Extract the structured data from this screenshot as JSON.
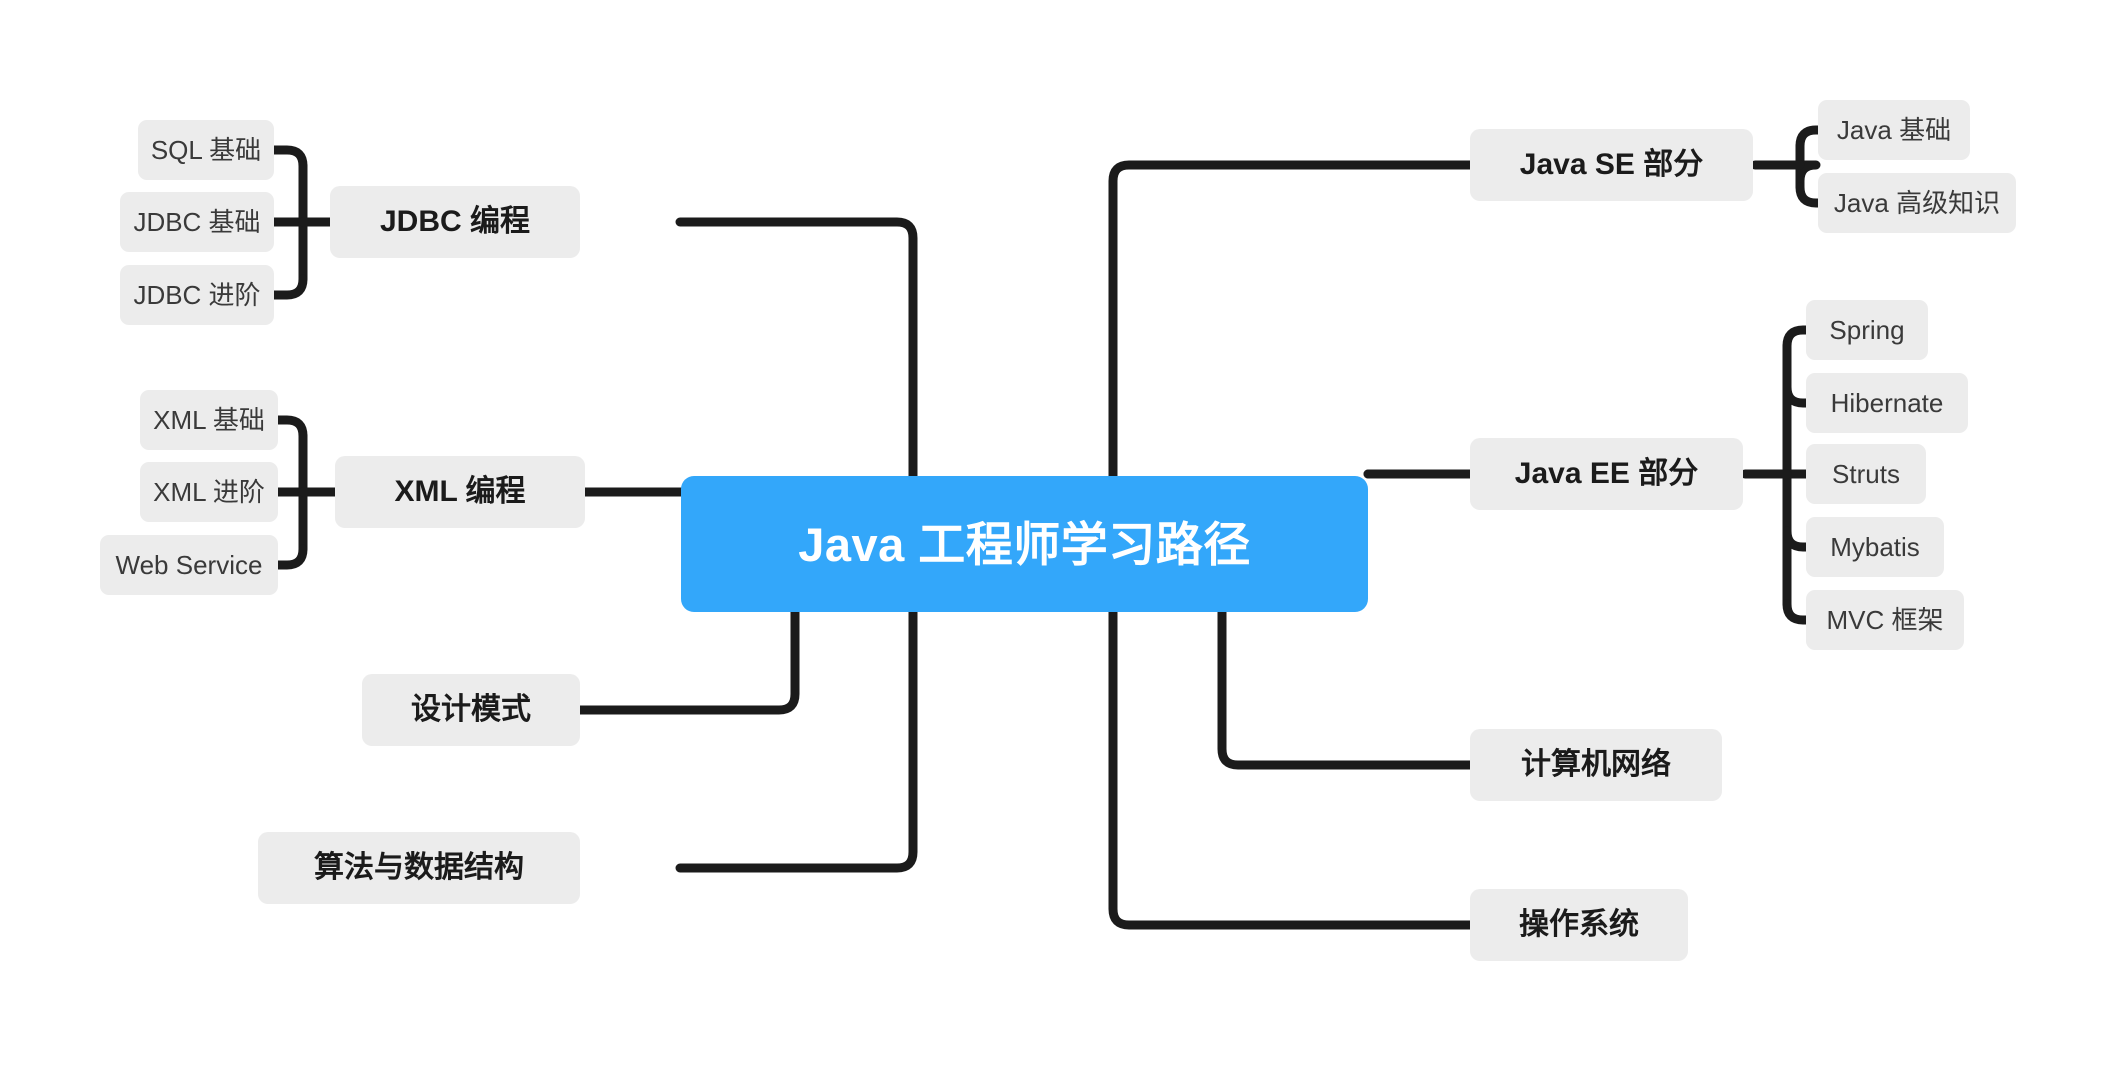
{
  "diagram": {
    "type": "mindmap",
    "title": "Java 工程师学习路径",
    "orientation": "horizontal-bidirectional",
    "colors": {
      "root_background": "#33a7fa",
      "root_text": "#ffffff",
      "node_background": "#ececec",
      "branch_text": "#1b1b1b",
      "leaf_text": "#3a3a3a",
      "connector": "#1b1b1b",
      "canvas_background": "#ffffff"
    }
  },
  "root": {
    "label": "Java 工程师学习路径"
  },
  "left_branches": [
    {
      "id": "jdbc",
      "label": "JDBC 编程",
      "children": [
        {
          "label": "SQL 基础"
        },
        {
          "label": "JDBC 基础"
        },
        {
          "label": "JDBC 进阶"
        }
      ]
    },
    {
      "id": "xml",
      "label": "XML 编程",
      "children": [
        {
          "label": "XML 基础"
        },
        {
          "label": "XML 进阶"
        },
        {
          "label": "Web Service"
        }
      ]
    },
    {
      "id": "design-patterns",
      "label": "设计模式",
      "children": []
    },
    {
      "id": "algorithms",
      "label": "算法与数据结构",
      "children": []
    }
  ],
  "right_branches": [
    {
      "id": "java-se",
      "label": "Java SE 部分",
      "children": [
        {
          "label": "Java 基础"
        },
        {
          "label": "Java 高级知识"
        }
      ]
    },
    {
      "id": "java-ee",
      "label": "Java EE 部分",
      "children": [
        {
          "label": "Spring"
        },
        {
          "label": "Hibernate"
        },
        {
          "label": "Struts"
        },
        {
          "label": "Mybatis"
        },
        {
          "label": "MVC 框架"
        }
      ]
    },
    {
      "id": "network",
      "label": "计算机网络",
      "children": []
    },
    {
      "id": "os",
      "label": "操作系统",
      "children": []
    }
  ]
}
